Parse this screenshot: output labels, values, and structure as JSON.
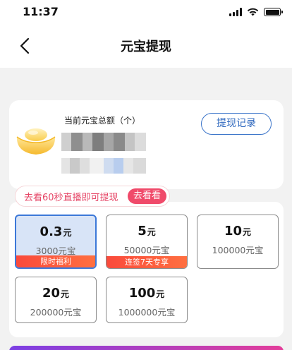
{
  "status": {
    "time": "11:37"
  },
  "nav": {
    "title": "元宝提现"
  },
  "balance": {
    "label": "当前元宝总额（个）"
  },
  "history_button": "提现记录",
  "tip": {
    "text": "去看60秒直播即可提现",
    "action": "去看看"
  },
  "options": [
    {
      "amount": "0.3",
      "unit": "元",
      "coins": "3000元宝",
      "tag": "限时福利",
      "selected": true
    },
    {
      "amount": "5",
      "unit": "元",
      "coins": "50000元宝",
      "tag": "连签7天专享"
    },
    {
      "amount": "10",
      "unit": "元",
      "coins": "100000元宝"
    },
    {
      "amount": "20",
      "unit": "元",
      "coins": "200000元宝"
    },
    {
      "amount": "100",
      "unit": "元",
      "coins": "1000000元宝"
    }
  ],
  "colors": {
    "accent_blue": "#3c78d8",
    "tag_red": "#fa4a3c",
    "tip_pink": "#f04a6a"
  }
}
